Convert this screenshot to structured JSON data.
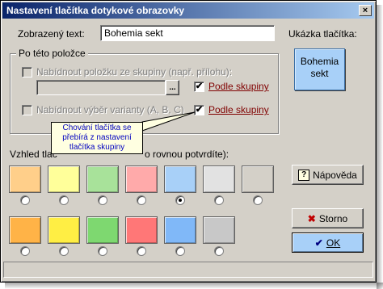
{
  "window": {
    "title": "Nastavení tlačítka dotykové obrazovky",
    "close_glyph": "×"
  },
  "display_text": {
    "label": "Zobrazený text:",
    "value": "Bohemia sekt"
  },
  "preview": {
    "label": "Ukázka tlačítka:",
    "line1": "Bohemia",
    "line2": "sekt"
  },
  "item_group": {
    "title": "Po této položce",
    "offer_item": {
      "label": "Nabídnout položku ze skupiny (např. přílohu):",
      "checked": false
    },
    "item_field": {
      "value": "",
      "browse_label": "..."
    },
    "by_group_1": {
      "label": "Podle skupiny",
      "checked": true,
      "mark": "✔"
    },
    "offer_variant": {
      "label": "Nabídnout výběr varianty (A, B, C)",
      "checked": false
    },
    "by_group_2": {
      "label": "Podle skupiny",
      "checked": true,
      "mark": "✔"
    }
  },
  "tooltip": {
    "line1": "Chování tlačítka se",
    "line2": "přebírá z nastavení",
    "line3": "tlačítka skupiny"
  },
  "appearance": {
    "label_left": "Vzhled tlač",
    "label_right": "o rovnou potvrdíte):",
    "row1": [
      "#ffcf8a",
      "#ffff9a",
      "#a8e29a",
      "#ffaaaa",
      "#a8d0f8",
      "#e2e2e2",
      "#d4d0c8"
    ],
    "row2": [
      "#ffb347",
      "#ffee44",
      "#7ed870",
      "#ff7777",
      "#80b8f8",
      "#c8c8c8"
    ],
    "selected": "row1-5"
  },
  "buttons": {
    "help": {
      "label": "Nápověda",
      "icon": "?"
    },
    "cancel": {
      "label": "Storno",
      "icon": "✖"
    },
    "ok": {
      "label": "OK",
      "icon": "✔"
    }
  }
}
